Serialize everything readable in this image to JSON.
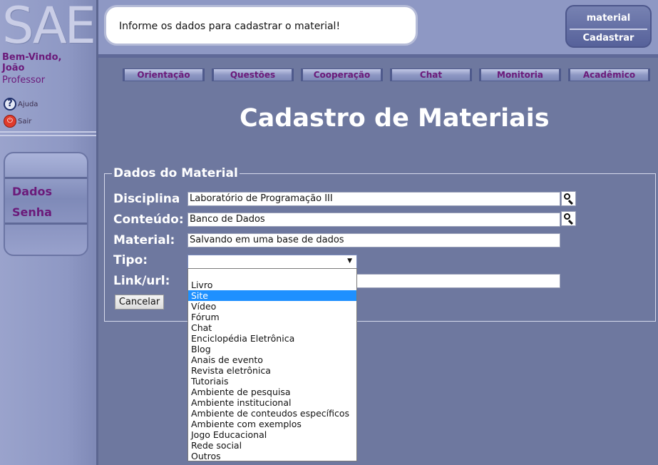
{
  "sidebar": {
    "logo": "SAE",
    "welcome_line1": "Bem-Vindo,",
    "welcome_line2": "João",
    "role": "Professor",
    "help_label": "Ajuda",
    "exit_label": "Sair",
    "help_icon": "question-icon",
    "exit_icon": "power-icon",
    "menu": [
      "Dados",
      "Senha"
    ]
  },
  "header": {
    "message": "Informe os dados para cadastrar o material!",
    "badge_line1": "material",
    "badge_line2": "Cadastrar"
  },
  "nav": [
    "Orientação",
    "Questões",
    "Cooperação",
    "Chat",
    "Monitoria",
    "Acadêmico"
  ],
  "main": {
    "title": "Cadastro de Materiais",
    "legend": "Dados do Material",
    "labels": {
      "disciplina": "Disciplina",
      "conteudo": "Conteúdo:",
      "material": "Material:",
      "tipo": "Tipo:",
      "link": "Link/url:"
    },
    "values": {
      "disciplina": "Laboratório de Programação III",
      "conteudo": "Banco de Dados",
      "material": "Salvando em uma base de dados",
      "tipo": "",
      "link": ""
    },
    "cancel_label": "Cancelar"
  },
  "tipo_options": [
    "",
    "Livro",
    "Site",
    "Vídeo",
    "Fórum",
    "Chat",
    "Enciclopédia Eletrônica",
    "Blog",
    "Anais de evento",
    "Revista eletrônica",
    "Tutoriais",
    "Ambiente de pesquisa",
    "Ambiente institucional",
    "Ambiente de conteudos específicos",
    "Ambiente com exemplos",
    "Jogo Educacional",
    "Rede social",
    "Outros"
  ],
  "tipo_highlighted": "Site",
  "colors": {
    "accent_purple": "#6b1a7a",
    "background": "#6e789f",
    "highlight": "#1e90ff"
  }
}
